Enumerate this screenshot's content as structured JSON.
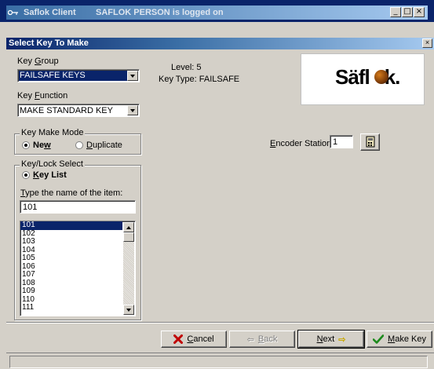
{
  "outer_window": {
    "app_name": "Saflok Client",
    "subtitle": "SAFLOK PERSON is logged on",
    "minimize": "_",
    "maximize": "□",
    "close": "×"
  },
  "dialog": {
    "title": "Select Key To Make",
    "close": "×"
  },
  "key_group": {
    "label_pre": "Key ",
    "label_accel": "G",
    "label_post": "roup",
    "value": "FAILSAFE KEYS"
  },
  "key_function": {
    "label_pre": "Key ",
    "label_accel": "F",
    "label_post": "unction",
    "value": "MAKE STANDARD KEY"
  },
  "info": {
    "level": "Level: 5",
    "key_type": "Key Type: FAILSAFE"
  },
  "logo": {
    "text_a": "Säfl",
    "text_b": "k."
  },
  "key_make_mode": {
    "legend": "Key Make Mode",
    "new_pre": "Ne",
    "new_accel": "w",
    "duplicate_accel": "D",
    "duplicate_post": "uplicate"
  },
  "encoder": {
    "label_accel": "E",
    "label_post": "ncoder Station:",
    "value": "1"
  },
  "key_lock_select": {
    "legend": "Key/Lock Select",
    "key_list_accel": "K",
    "key_list_post": "ey List",
    "search_label_accel": "T",
    "search_label_post": "ype the name of the item:",
    "search_value": "101",
    "items": [
      "101",
      "102",
      "103",
      "104",
      "105",
      "106",
      "107",
      "108",
      "109",
      "110",
      "111"
    ]
  },
  "buttons": {
    "cancel_accel": "C",
    "cancel_post": "ancel",
    "back_arrow": "⇦",
    "back_accel": "B",
    "back_post": "ack",
    "next_accel": "N",
    "next_post": "ext",
    "next_arrow": "⇨",
    "make_key_accel": "M",
    "make_key_post": "ake Key"
  },
  "colors": {
    "titlebar": "#0a246a",
    "face": "#d4d0c8",
    "selection": "#0a246a",
    "cancel_x": "#c00000",
    "make_check": "#1c8a1c",
    "next_arrow": "#d8c000"
  }
}
